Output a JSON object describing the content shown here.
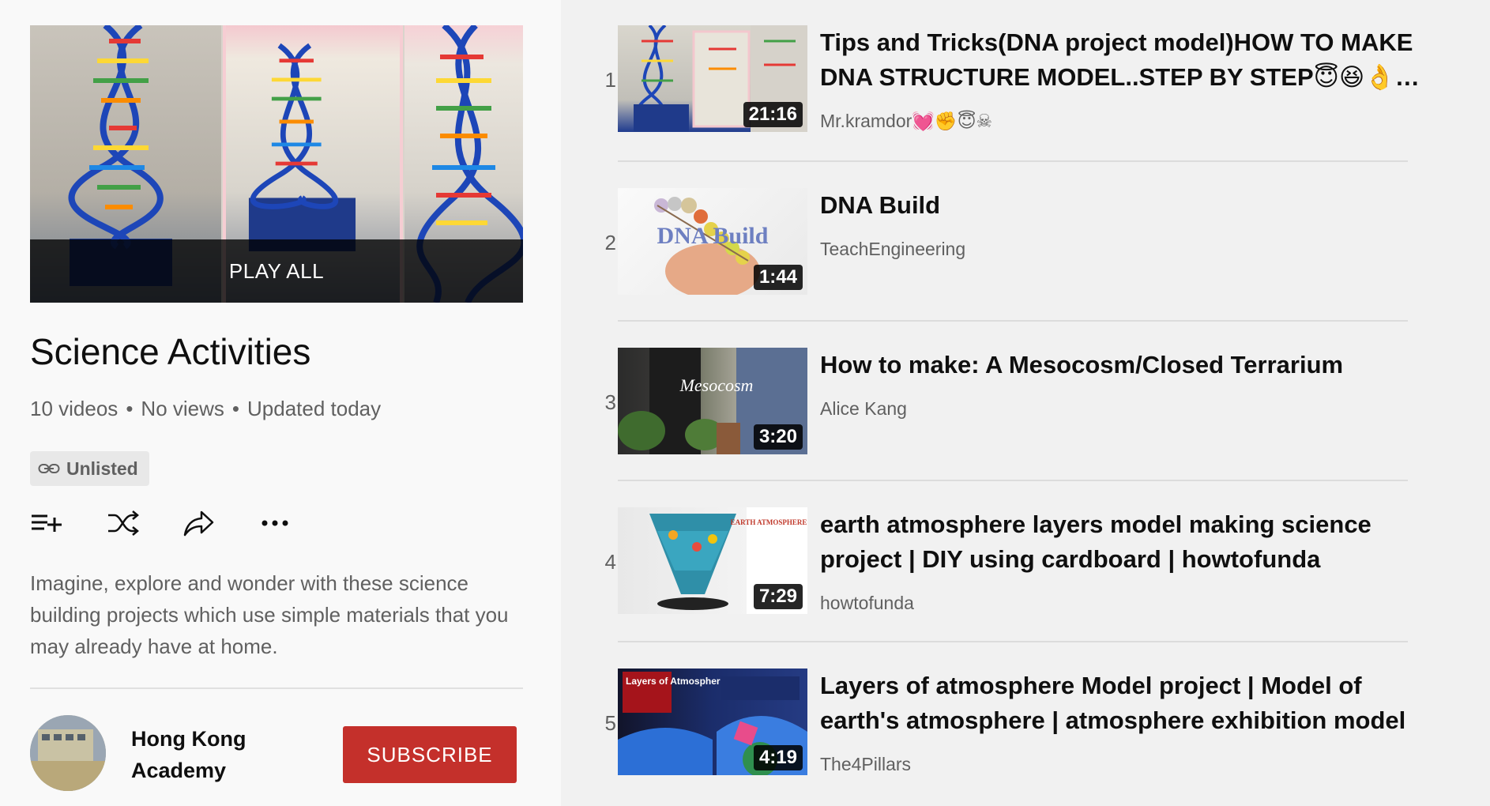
{
  "sidebar": {
    "play_all_label": "PLAY ALL",
    "title": "Science Activities",
    "meta": {
      "video_count": "10 videos",
      "views": "No views",
      "updated": "Updated today"
    },
    "privacy_label": "Unlisted",
    "description": "Imagine, explore and wonder with these science building projects which use simple materials that you may already have at home.",
    "channel_name": "Hong Kong Academy",
    "subscribe_label": "SUBSCRIBE"
  },
  "videos": [
    {
      "index": "1",
      "title": "Tips and Tricks(DNA project model)HOW TO MAKE DNA STRUCTURE MODEL..STEP BY STEP😇😆👌…",
      "channel": "Mr.kramdor💓✊😇☠",
      "duration": "21:16"
    },
    {
      "index": "2",
      "title": "DNA Build",
      "channel": "TeachEngineering",
      "duration": "1:44",
      "thumb_text": "DNA Build"
    },
    {
      "index": "3",
      "title": "How to make: A Mesocosm/Closed Terrarium",
      "channel": "Alice Kang",
      "duration": "3:20",
      "thumb_text": "Mesocosm"
    },
    {
      "index": "4",
      "title": "earth atmosphere layers model making science project | DIY using cardboard | howtofunda",
      "channel": "howtofunda",
      "duration": "7:29",
      "thumb_text": "EARTH ATMOSPHERE LAYERS"
    },
    {
      "index": "5",
      "title": "Layers of atmosphere Model project | Model of earth's atmosphere | atmosphere exhibition model",
      "channel": "The4Pillars",
      "duration": "4:19",
      "thumb_text": "Layers of Atmosphere"
    }
  ],
  "colors": {
    "subscribe": "#c4302b",
    "text_primary": "#0f0f0f",
    "text_secondary": "#606060",
    "list_bg": "#f1f1f1",
    "sidebar_bg": "#f9f9f9"
  },
  "icons": [
    "link-icon",
    "add-to-queue-icon",
    "shuffle-icon",
    "share-icon",
    "more-icon"
  ]
}
